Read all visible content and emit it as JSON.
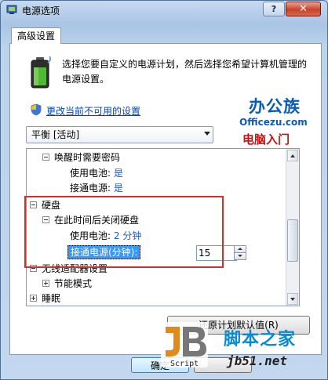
{
  "window": {
    "title": "电源选项",
    "help_label": "?",
    "close_label": "✕"
  },
  "tab": {
    "label": "高级设置"
  },
  "intro": {
    "description": "选择您要自定义的电源计划，然后选择您希望计算机管理的电源设置。",
    "change_link": "更改当前不可用的设置"
  },
  "plan_select": {
    "value": "平衡 [活动]"
  },
  "logo": {
    "chinese": "办公族",
    "site": "Officezu.com",
    "subtitle": "电脑入门"
  },
  "tree": {
    "wake_password": "唤醒时需要密码",
    "on_battery_label": "使用电池:",
    "wake_battery_value": "是",
    "plugged_in_label": "接通电源:",
    "wake_plugged_value": "是",
    "hard_disk": "硬盘",
    "turn_off_disk": "在此时间后关闭硬盘",
    "disk_battery_value": "2 分钟",
    "plugged_minutes_label": "接通电源(分钟):",
    "plugged_minutes_value": "15",
    "wireless": "无线适配器设置",
    "power_saving": "节能模式",
    "sleep": "睡眠"
  },
  "buttons": {
    "restore": "还原计划默认值(R)",
    "ok": "确定",
    "cancel": ""
  },
  "watermark": {
    "script": "Script",
    "chinese": "脚本之家",
    "url": "jb51.net"
  },
  "colors": {
    "value_blue": "#1a58c9",
    "highlight_red": "#d03030",
    "selection_blue": "#3399ff"
  }
}
